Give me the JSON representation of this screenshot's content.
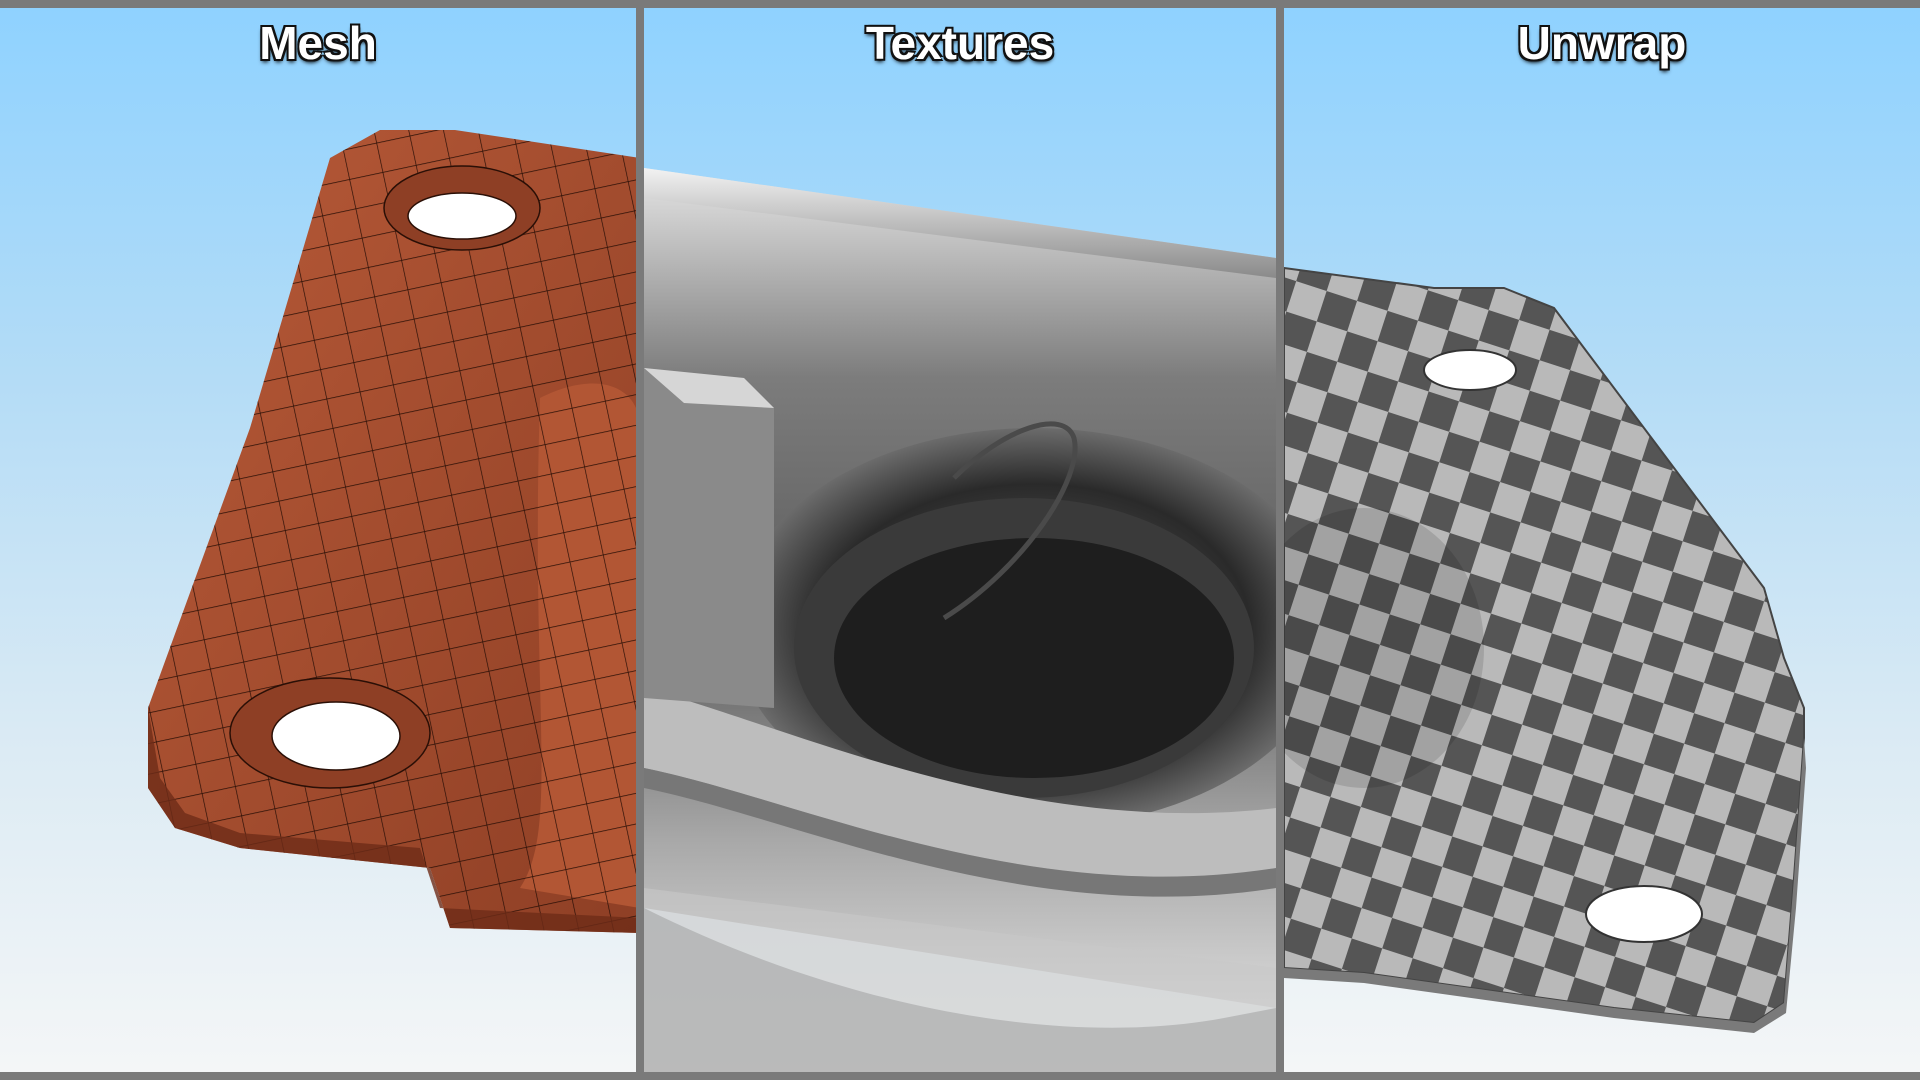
{
  "panels": [
    {
      "title": "Mesh"
    },
    {
      "title": "Textures"
    },
    {
      "title": "Unwrap"
    }
  ],
  "colors": {
    "mesh_fill": "#a24a2e",
    "mesh_wire": "#2a0f06",
    "metal": "#9a9a9a",
    "checker_dark": "#555555",
    "checker_light": "#b9b9b9",
    "sky_top": "#8fd2ff",
    "sky_bottom": "#f4f6f7",
    "divider": "#7a7a7a"
  }
}
